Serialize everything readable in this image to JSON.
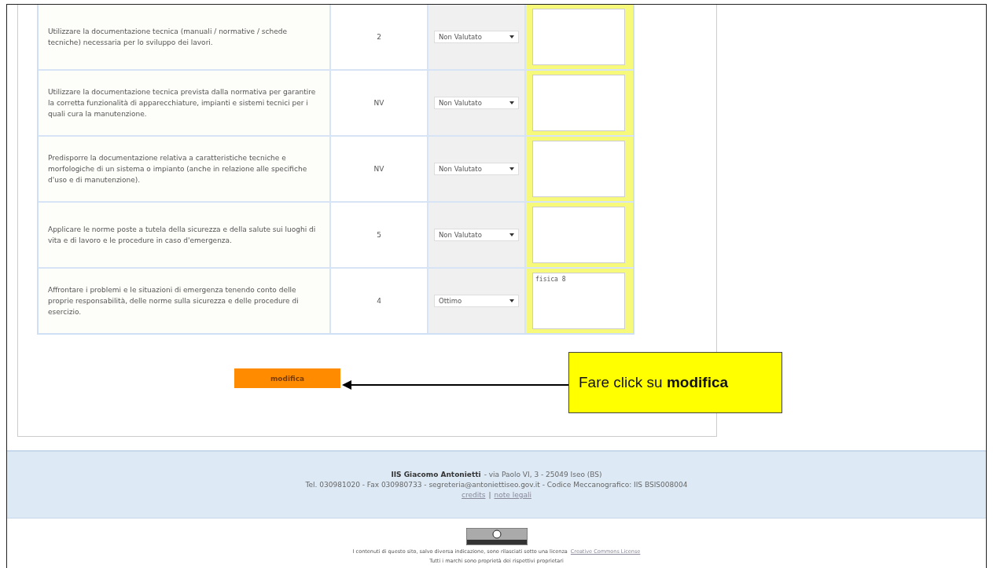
{
  "rows": [
    {
      "description": "Utilizzare la documentazione tecnica (manuali / normative / schede tecniche) necessaria per lo sviluppo dei lavori.",
      "value": "2",
      "select": "Non Valutato",
      "note": ""
    },
    {
      "description": "Utilizzare la documentazione tecnica prevista dalla normativa per garantire la corretta funzionalità di apparecchiature, impianti e sistemi tecnici per i quali cura la manutenzione.",
      "value": "NV",
      "select": "Non Valutato",
      "note": ""
    },
    {
      "description": "Predisporre la documentazione relativa a caratteristiche tecniche e morfologiche di un sistema o impianto (anche in relazione alle specifiche d'uso e di manutenzione).",
      "value": "NV",
      "select": "Non Valutato",
      "note": ""
    },
    {
      "description": "Applicare le norme poste a tutela della sicurezza e della salute sui luoghi di vita e di lavoro e le procedure in caso d'emergenza.",
      "value": "5",
      "select": "Non Valutato",
      "note": ""
    },
    {
      "description": "Affrontare i problemi e le situazioni di emergenza tenendo conto delle proprie responsabilità, delle norme sulla sicurezza e delle procedure di esercizio.",
      "value": "4",
      "select": "Ottimo",
      "note": "fisica 8"
    }
  ],
  "submit_button": "modifica",
  "callout": "Fare click su **modifica**",
  "footer": {
    "school": "IIS Giacomo Antonietti",
    "address": " - via Paolo VI, 3 - 25049 Iseo (BS)",
    "contacts": "Tel. 030981020 - Fax 030980733 - segreteria@antoniettiseo.gov.it - Codice Meccanografico: IIS BSIS008004",
    "links": [
      "credits",
      "note legali"
    ],
    "separator": "|"
  },
  "license": {
    "text": "I contenuti di questo sito, salvo diversa indicazione, sono rilasciati sotto una licenza",
    "link": "Creative Commons License",
    "trademarks": "Tutti i marchi sono proprietà dei rispettivi proprietari"
  }
}
